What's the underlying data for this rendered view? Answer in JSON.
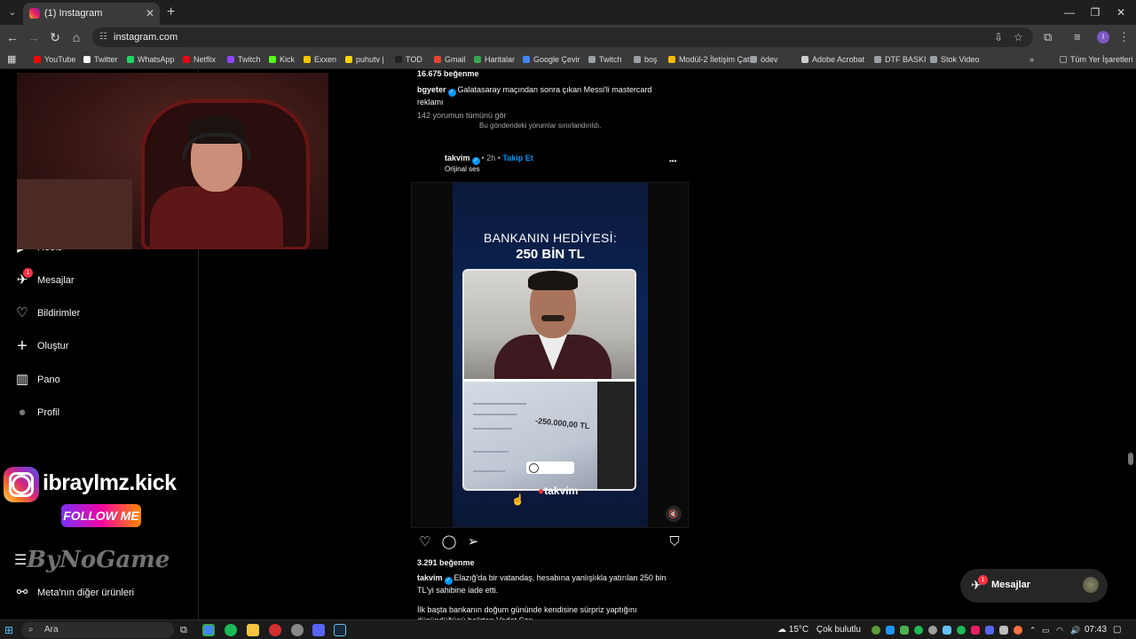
{
  "browser": {
    "tab_title": "(1) Instagram",
    "tab_close": "✕",
    "new_tab": "+",
    "url": "instagram.com",
    "profile_initial": "I",
    "window_controls": {
      "minimize": "—",
      "restore": "❐",
      "close": "✕"
    },
    "nav": {
      "back": "←",
      "forward": "→",
      "reload": "↻",
      "home": "⌂"
    },
    "bookmarks": [
      {
        "label": "YouTube",
        "color": "#ff0000"
      },
      {
        "label": "Twitter",
        "color": "#ffffff"
      },
      {
        "label": "WhatsApp",
        "color": "#25d366"
      },
      {
        "label": "Netflix",
        "color": "#e50914"
      },
      {
        "label": "Twitch",
        "color": "#9146ff"
      },
      {
        "label": "Kick",
        "color": "#53fc18"
      },
      {
        "label": "Exxen",
        "color": "#f5c400"
      },
      {
        "label": "puhutv |",
        "color": "#ffd400"
      },
      {
        "label": "TOD",
        "color": "#222222"
      },
      {
        "label": "Gmail",
        "color": "#ea4335"
      },
      {
        "label": "Haritalar",
        "color": "#34a853"
      },
      {
        "label": "Google Çevir",
        "color": "#4285f4"
      },
      {
        "label": "Twitch",
        "color": "#9aa0a6"
      },
      {
        "label": "boş",
        "color": "#9aa0a6"
      },
      {
        "label": "Modül-2 İletişim Çat...",
        "color": "#fbbc04"
      },
      {
        "label": "ödev",
        "color": "#9aa0a6"
      },
      {
        "label": "Adobe Acrobat",
        "color": "#cccccc"
      },
      {
        "label": "DTF BASKI",
        "color": "#9aa0a6"
      },
      {
        "label": "Stok Video",
        "color": "#9aa0a6"
      }
    ],
    "more_bookmarks": "»",
    "all_bookmarks": "Tüm Yer İşaretleri"
  },
  "sidebar": {
    "items": [
      {
        "label": "Reels",
        "icon": "reels-icon",
        "glyph": "▶"
      },
      {
        "label": "Mesajlar",
        "icon": "messages-icon",
        "glyph": "✈",
        "badge": "1"
      },
      {
        "label": "Bildirimler",
        "icon": "heart-icon",
        "glyph": "♡"
      },
      {
        "label": "Oluştur",
        "icon": "plus-icon",
        "glyph": "+"
      },
      {
        "label": "Pano",
        "icon": "dashboard-icon",
        "glyph": "▥"
      },
      {
        "label": "Profil",
        "icon": "profile-avatar-icon",
        "glyph": "●"
      }
    ],
    "more_label": "Meta'nın diğer ürünleri",
    "more_glyph": "⚯"
  },
  "overlay": {
    "brand_handle": "ibraylmz.kick",
    "follow": "FOLLOW ME",
    "watermark": "ByNoGame"
  },
  "feed": {
    "prev_post": {
      "likes": "16.675 beğenme",
      "username": "bgyeter",
      "caption": "Galatasaray maçından sonra çıkan Messi'li mastercard reklamı",
      "comments_link": "142 yorumun tümünü gör",
      "comments_limited": "Bu gönderideki yorumlar sınırlandırıldı."
    },
    "post": {
      "username": "takvim",
      "time": "2h",
      "separator": "•",
      "follow": "Takip Et",
      "audio": "Orijinal ses",
      "more": "•••",
      "reel": {
        "title_line1": "BANKANIN HEDİYESİ:",
        "title_line2": "250 BİN TL",
        "doc_amount": "-250.000,00 TL",
        "brand": "takvim"
      },
      "likes": "3.291 beğenme",
      "caption": "Elazığ'da bir vatandaş, hesabına yanlışlıkla yatırılan 250 bin TL'yi sahibine iade etti.",
      "caption_more": "İlk başta bankanın doğum gününde kendisine sürpriz yaptığını düşündüğünü belirten Vedat Sarı..."
    }
  },
  "messages_float": {
    "label": "Mesajlar",
    "badge": "1"
  },
  "taskbar": {
    "search_placeholder": "Ara",
    "weather": "15°C",
    "weather_desc": "Çok bulutlu",
    "time": "07:43"
  }
}
